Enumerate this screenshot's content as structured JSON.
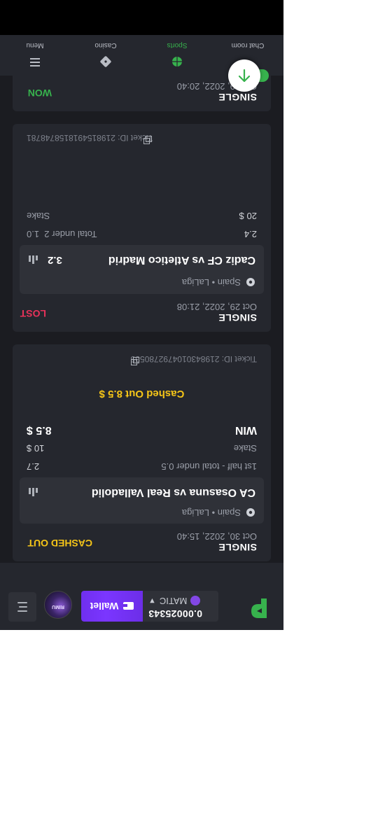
{
  "header": {
    "balance_amount": "0.00025343",
    "currency": "MATIC",
    "wallet_label": "Wallet",
    "avatar_text": "RIMU"
  },
  "bets": [
    {
      "kind": "SINGLE",
      "date": "Oct 30, 2022, 15:40",
      "status": "CASHED OUT",
      "league": "Spain • LaLiga",
      "match": "CA Osasuna vs Real Valladolid",
      "market": "1st half - total under 0.5",
      "odds": "2.7",
      "stake_label": "Stake",
      "stake": "10 $",
      "win_label": "WIN",
      "win_amount": "8.5 $",
      "cashed_text": "Cashed Out 8.5 $",
      "ticket": "Ticket ID: 2198430104792780535"
    },
    {
      "kind": "SINGLE",
      "date": "Oct 29, 2022, 21:08",
      "status": "LOST",
      "league": "Spain • LaLiga",
      "match": "Cadiz CF vs Atletico Madrid",
      "odds": "3.2",
      "market": "Total under 2",
      "market_odds": "1.0",
      "stake_label": "Stake",
      "stake": "20 $",
      "payout": "2.4",
      "ticket": "Ticket ID: 2198154918158748781"
    },
    {
      "kind": "SINGLE",
      "date": "Oct 29, 2022, 20:40",
      "status": "WON"
    }
  ],
  "nav": {
    "items": [
      "Menu",
      "Casino",
      "Sports",
      "Chat room"
    ]
  },
  "colors": {
    "won": "#37b24d",
    "lost": "#e8325a",
    "cashed": "#f5c518",
    "wallet": "#7b36ff"
  }
}
